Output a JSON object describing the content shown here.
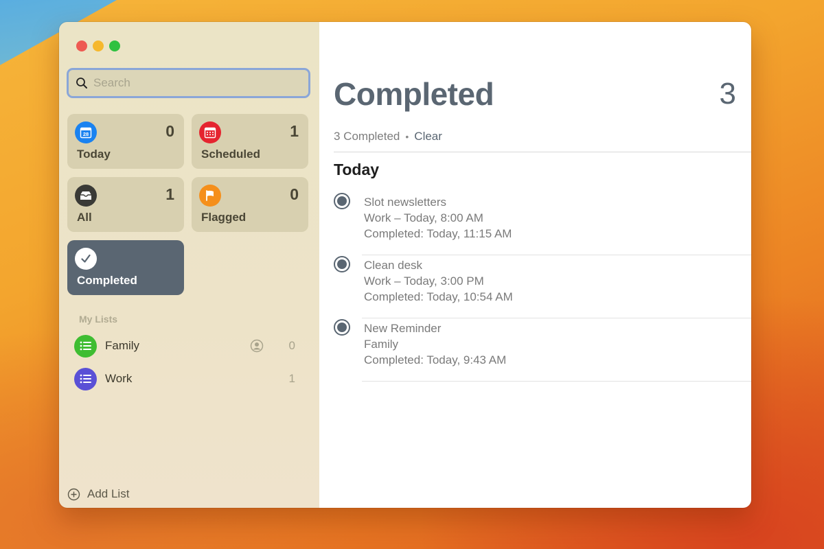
{
  "window": {
    "traffic_lights": [
      "close",
      "minimize",
      "maximize"
    ]
  },
  "sidebar": {
    "search": {
      "placeholder": "Search",
      "value": ""
    },
    "smart_lists": [
      {
        "label": "Today",
        "count": "0",
        "icon": "calendar-today-icon",
        "icon_text": "28",
        "color": "#1a82f0"
      },
      {
        "label": "Scheduled",
        "count": "1",
        "icon": "calendar-icon",
        "color": "#e5242f"
      },
      {
        "label": "All",
        "count": "1",
        "icon": "tray-icon",
        "color": "#3a3a36"
      },
      {
        "label": "Flagged",
        "count": "0",
        "icon": "flag-icon",
        "color": "#f58f1b"
      },
      {
        "label": "Completed",
        "icon": "checkmark-icon",
        "color": "#ffffff",
        "selected": true
      }
    ],
    "my_lists_header": "My Lists",
    "lists": [
      {
        "name": "Family",
        "count": "0",
        "color": "#3fbd32",
        "shared": true
      },
      {
        "name": "Work",
        "count": "1",
        "color": "#5a50d6",
        "shared": false
      }
    ],
    "add_list_label": "Add List"
  },
  "main": {
    "title": "Completed",
    "count": "3",
    "summary": "3 Completed",
    "separator": "•",
    "clear_label": "Clear",
    "section_title": "Today",
    "accent_color": "#5a6672",
    "items": [
      {
        "title": "Slot newsletters",
        "detail": "Work – Today, 8:00 AM",
        "completed": "Completed: Today, 11:15 AM"
      },
      {
        "title": "Clean desk",
        "detail": "Work – Today, 3:00 PM",
        "completed": "Completed: Today, 10:54 AM"
      },
      {
        "title": "New Reminder",
        "detail": "Family",
        "completed": "Completed: Today, 9:43 AM"
      }
    ]
  }
}
